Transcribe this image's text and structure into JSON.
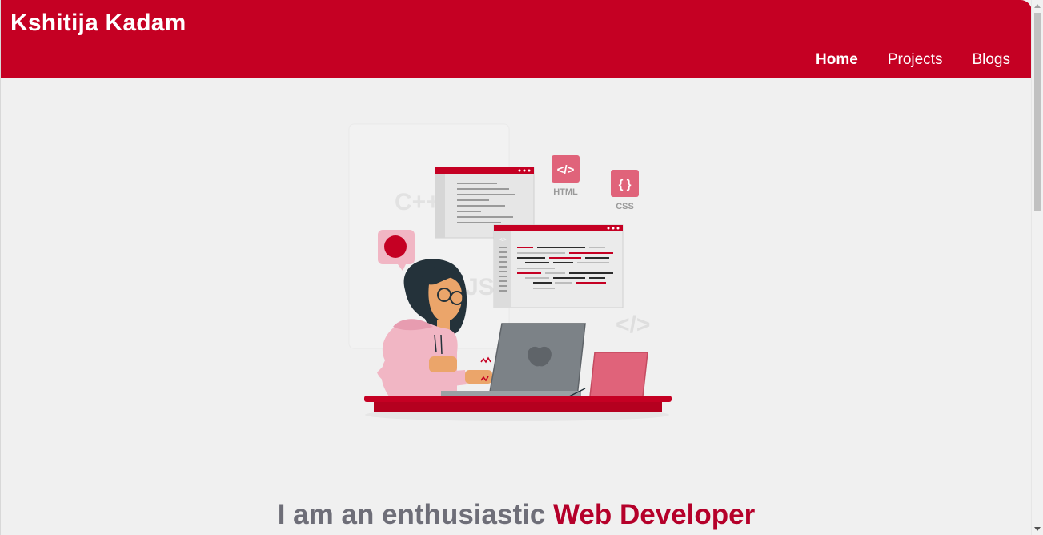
{
  "header": {
    "brand": "Kshitija Kadam",
    "nav": [
      {
        "label": "Home",
        "active": true
      },
      {
        "label": "Projects",
        "active": false
      },
      {
        "label": "Blogs",
        "active": false
      }
    ],
    "color": "#c50023"
  },
  "hero": {
    "illustration": {
      "name": "developer-at-laptop-illustration",
      "labels": {
        "html": "HTML",
        "css": "CSS",
        "cpp": "C++",
        "js": "JS",
        "html_tag_glyph": "</>",
        "css_glyph": "{ }",
        "code_glyph": "</>"
      }
    },
    "headline_prefix": "I am an enthusiastic",
    "headline_accent": "Web Developer",
    "accent_color": "#b5002a"
  }
}
